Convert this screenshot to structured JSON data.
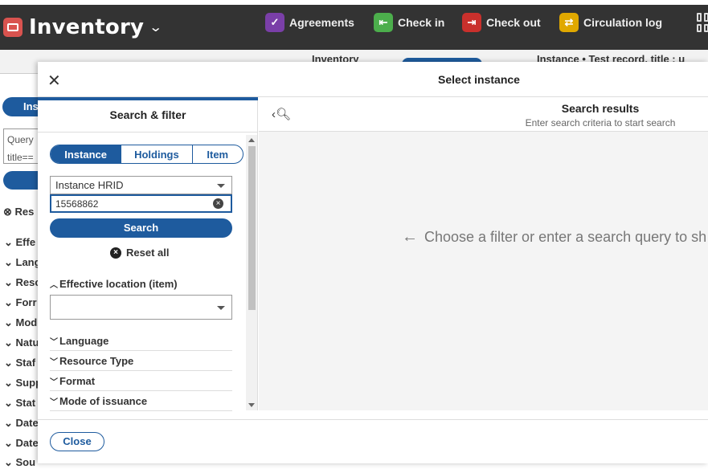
{
  "topbar": {
    "app_title": "Inventory",
    "app_icon": "inventory-icon",
    "nav": [
      {
        "label": "Agreements",
        "icon": "agreements-icon",
        "color": "#7a3fa8"
      },
      {
        "label": "Check in",
        "icon": "check-in-icon",
        "color": "#4cae4c"
      },
      {
        "label": "Check out",
        "icon": "check-out-icon",
        "color": "#c9302c"
      },
      {
        "label": "Circulation log",
        "icon": "circulation-log-icon",
        "color": "#e0a800"
      }
    ]
  },
  "background": {
    "tabs": [
      "Inventory",
      "Instance • Test record, title : u"
    ],
    "left": {
      "segment_label": "Ins",
      "query_lines": [
        "Query",
        "title=="
      ],
      "reset_label": "Res",
      "accordions": [
        "Effe",
        "Lang",
        "Resc",
        "Forr",
        "Mod",
        "Natu",
        "Staf",
        "Supp",
        "Stat",
        "Date",
        "Date",
        "Sou"
      ]
    }
  },
  "modal": {
    "title": "Select instance",
    "filter_pane": {
      "title": "Search & filter",
      "segments": [
        "Instance",
        "Holdings",
        "Item"
      ],
      "search_option": "Instance HRID",
      "search_value": "15568862",
      "search_button": "Search",
      "reset_all": "Reset all",
      "location_label": "Effective location (item)",
      "accordions": [
        "Language",
        "Resource Type",
        "Format",
        "Mode of issuance"
      ]
    },
    "results_pane": {
      "title": "Search results",
      "subtitle": "Enter search criteria to start search",
      "empty_message": "Choose a filter or enter a search query to sh"
    },
    "footer": {
      "close_label": "Close"
    }
  },
  "colors": {
    "accent": "#1e5b9e",
    "topbar": "#333333"
  }
}
